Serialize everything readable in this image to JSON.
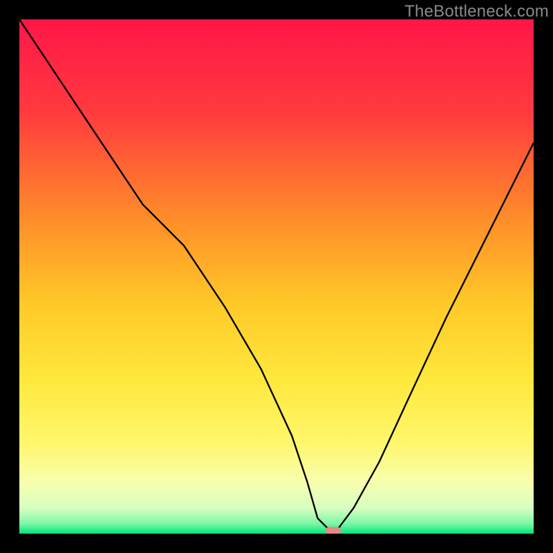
{
  "watermark": "TheBottleneck.com",
  "chart_data": {
    "type": "line",
    "title": "",
    "xlabel": "",
    "ylabel": "",
    "xlim": [
      0,
      100
    ],
    "ylim": [
      0,
      100
    ],
    "series": [
      {
        "name": "bottleneck-curve",
        "x": [
          0,
          8,
          16,
          24,
          32,
          40,
          47,
          53,
          56,
          58,
          60,
          62,
          65,
          70,
          76,
          83,
          90,
          100
        ],
        "y": [
          100,
          88,
          76,
          64,
          56,
          44,
          32,
          19,
          10,
          3,
          1,
          1,
          5,
          14,
          27,
          42,
          56,
          76
        ]
      }
    ],
    "gradient_stops": [
      {
        "offset": 0,
        "color": "#ff1648"
      },
      {
        "offset": 18,
        "color": "#ff3a3e"
      },
      {
        "offset": 38,
        "color": "#ff8a2a"
      },
      {
        "offset": 55,
        "color": "#ffc828"
      },
      {
        "offset": 70,
        "color": "#ffe83c"
      },
      {
        "offset": 82,
        "color": "#fff66a"
      },
      {
        "offset": 90,
        "color": "#f7ffae"
      },
      {
        "offset": 95,
        "color": "#d8ffc0"
      },
      {
        "offset": 98,
        "color": "#80f7a8"
      },
      {
        "offset": 100,
        "color": "#00e67a"
      }
    ],
    "marker": {
      "x": 61,
      "y": 0.5,
      "color": "#e38b82"
    }
  }
}
